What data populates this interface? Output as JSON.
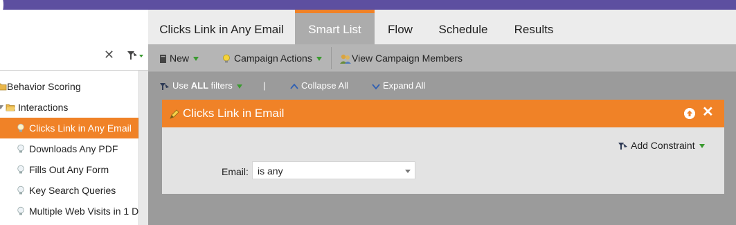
{
  "tabs": [
    "Clicks Link in Any Email",
    "Smart List",
    "Flow",
    "Schedule",
    "Results"
  ],
  "toolbar": {
    "new_label": "New",
    "campaign_actions_label": "Campaign Actions",
    "view_members_label": "View Campaign Members"
  },
  "filterbar": {
    "use_prefix": "Use",
    "use_bold": "ALL",
    "use_suffix": "filters",
    "separator": "|",
    "collapse_all": "Collapse All",
    "expand_all": "Expand All"
  },
  "sidebar": {
    "close_glyph": "✕",
    "items": [
      {
        "label": "Behavior Scoring",
        "icon": "folder-icon"
      },
      {
        "label": "Interactions",
        "icon": "folder-icon"
      },
      {
        "label": "Clicks Link in Any Email",
        "icon": "lightbulb-icon",
        "selected": true
      },
      {
        "label": "Downloads Any PDF",
        "icon": "lightbulb-icon"
      },
      {
        "label": "Fills Out Any Form",
        "icon": "lightbulb-icon"
      },
      {
        "label": "Key Search Queries",
        "icon": "lightbulb-icon"
      },
      {
        "label": "Multiple Web Visits in 1 D",
        "icon": "lightbulb-icon"
      }
    ]
  },
  "filter_card": {
    "title": "Clicks Link in Email",
    "add_constraint": "Add Constraint",
    "close_glyph": "✕",
    "field_label": "Email:",
    "field_value": "is any"
  },
  "colors": {
    "accent": "#f08227",
    "topbar": "#5d4fa0",
    "workspace": "#9b9b9b",
    "toolbar": "#b5b5b5"
  }
}
